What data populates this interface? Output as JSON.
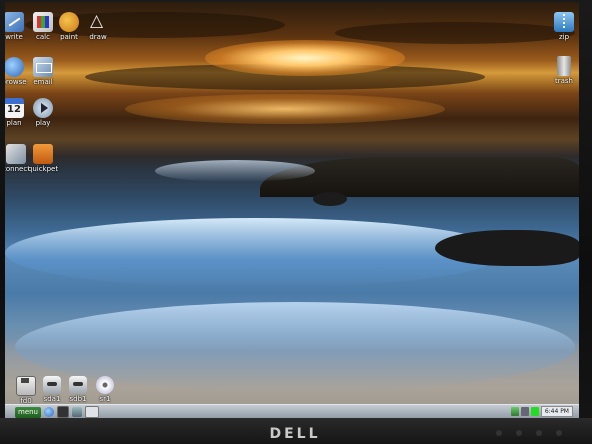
{
  "monitor": {
    "brand": "DELL"
  },
  "desktop": {
    "left_icons": [
      {
        "label": "write",
        "icon": "write-icon"
      },
      {
        "label": "calc",
        "icon": "calc-icon"
      },
      {
        "label": "paint",
        "icon": "paint-icon"
      },
      {
        "label": "draw",
        "icon": "draw-icon"
      },
      {
        "label": "browse",
        "icon": "browse-icon"
      },
      {
        "label": "email",
        "icon": "email-icon"
      },
      {
        "label": "plan",
        "icon": "calendar-icon",
        "glyph": "12"
      },
      {
        "label": "play",
        "icon": "play-icon"
      },
      {
        "label": "connect",
        "icon": "connect-icon"
      },
      {
        "label": "quickpet",
        "icon": "quickpet-icon"
      }
    ],
    "right_icons": [
      {
        "label": "zip",
        "icon": "zip-icon"
      },
      {
        "label": "trash",
        "icon": "trash-icon"
      }
    ],
    "drives": [
      {
        "label": "fd0",
        "icon": "floppy-icon"
      },
      {
        "label": "sda1",
        "icon": "hard-disk-icon"
      },
      {
        "label": "sdb1",
        "icon": "hard-disk-icon"
      },
      {
        "label": "sr1",
        "icon": "cd-icon"
      }
    ]
  },
  "taskbar": {
    "menu_label": "menu",
    "clock": "6:44 PM"
  }
}
